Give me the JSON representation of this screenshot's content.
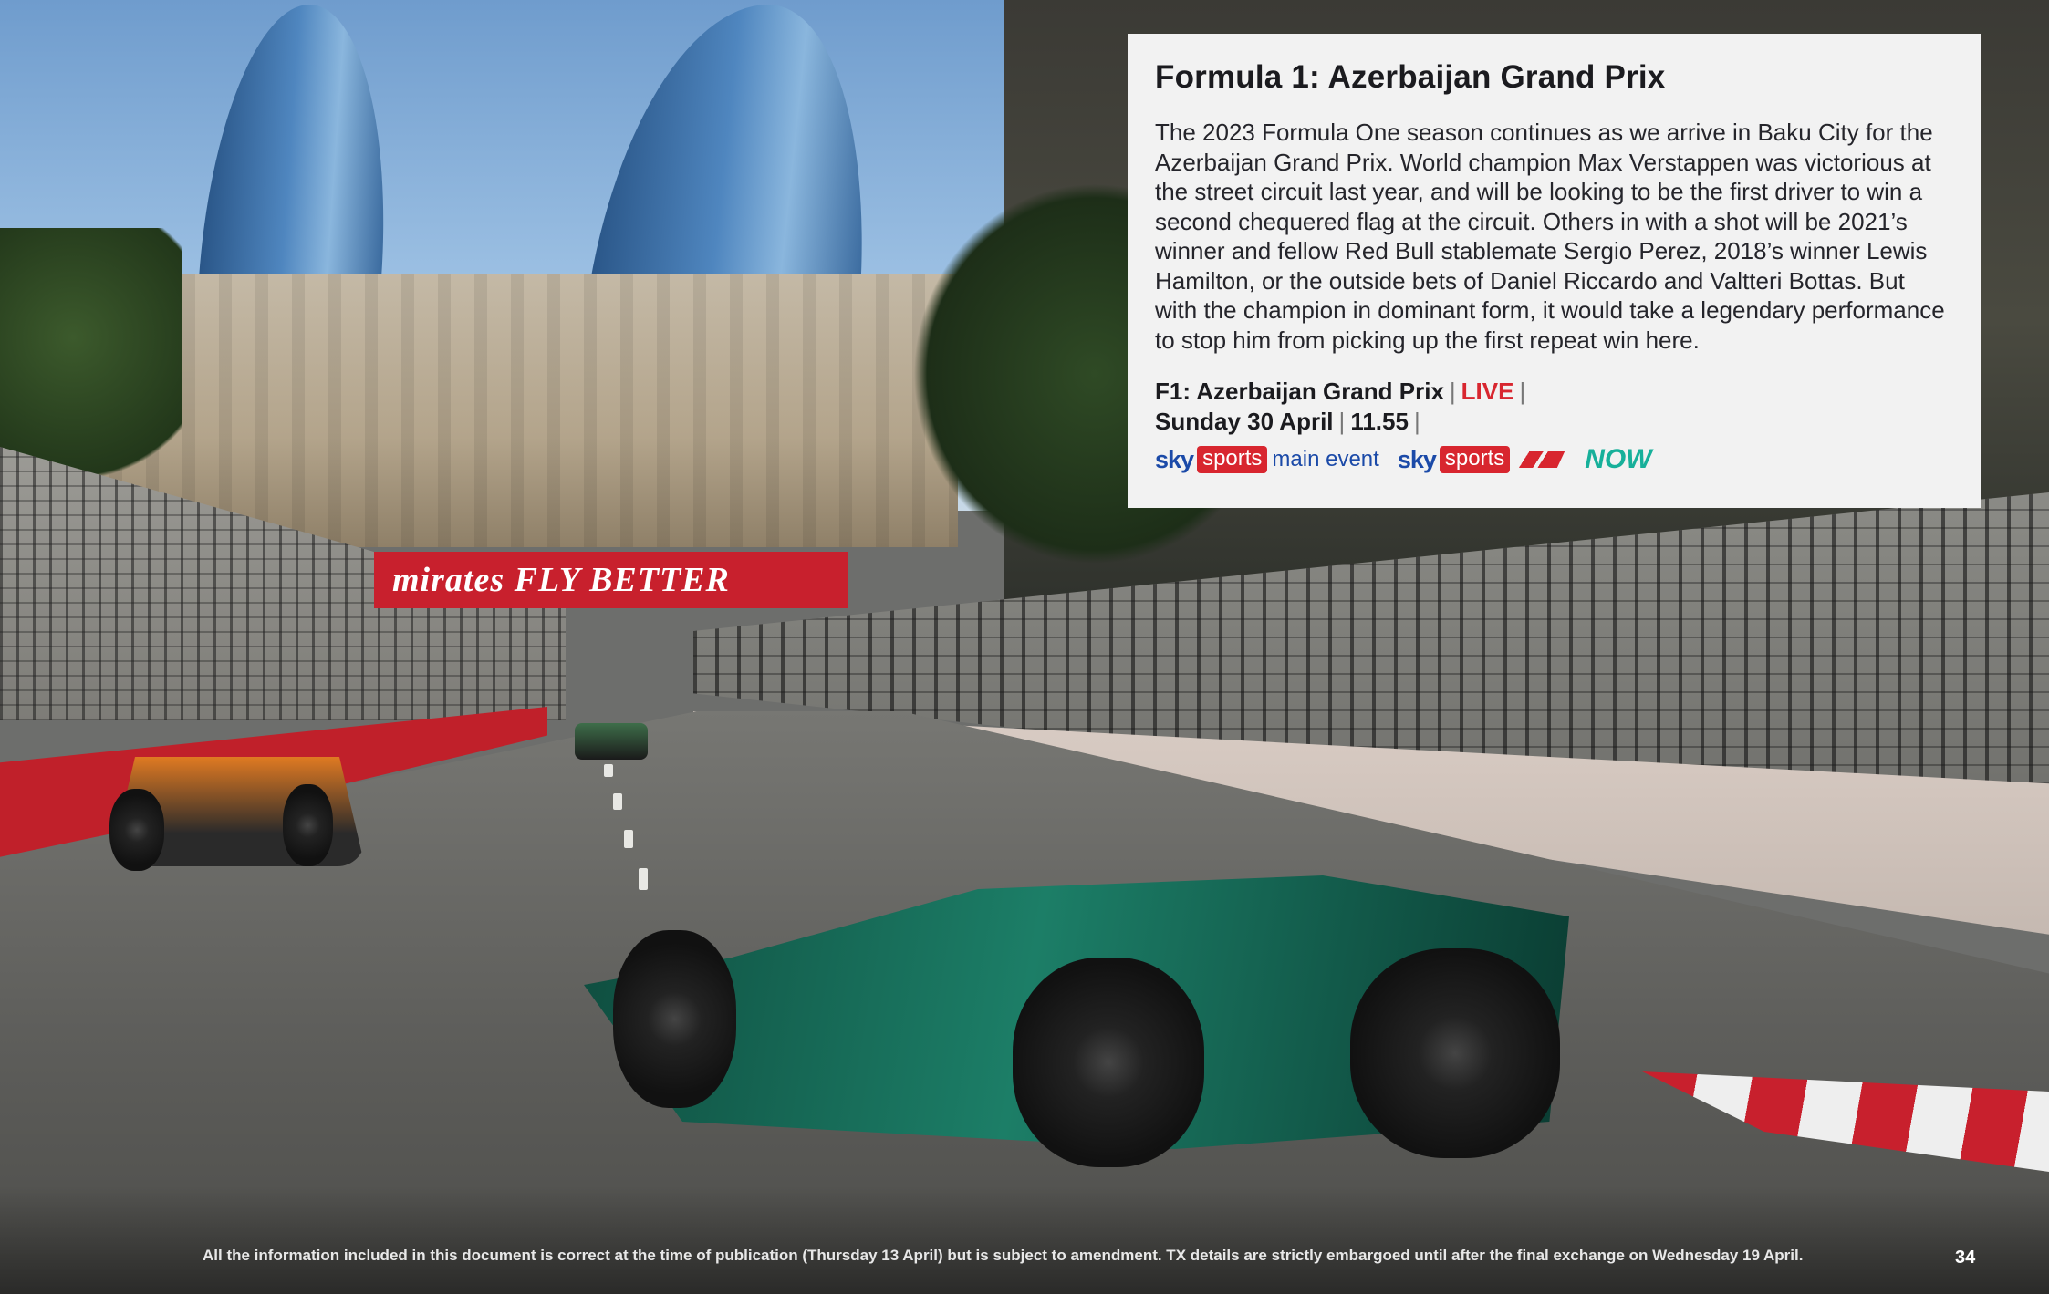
{
  "card": {
    "title": "Formula 1: Azerbaijan Grand Prix",
    "description": "The 2023 Formula One season continues as we arrive in Baku City for the Azerbaijan Grand Prix. World champion Max Verstappen was victorious at the street circuit last year, and will be looking to be the first driver to win a second chequered flag at the circuit. Others in with a shot will be 2021’s winner and fellow Red Bull stablemate Sergio Perez, 2018’s winner Lewis Hamilton, or the outside bets of Daniel Riccardo and Valtteri Bottas. But with the champion in dominant form, it would take a legendary performance to stop him from picking up the first repeat win here.",
    "listing": {
      "event": "F1: Azerbaijan Grand Prix",
      "live_label": "LIVE",
      "date": "Sunday 30 April",
      "time": "11.55",
      "separator": "|"
    },
    "channels": [
      {
        "sky": "sky",
        "sports": "sports",
        "sub": "main event"
      },
      {
        "sky": "sky",
        "sports": "sports",
        "sub_icon": "f1-logo-icon"
      },
      {
        "name": "NOW"
      }
    ]
  },
  "photo": {
    "banner_text": "mirates FLY BETTER",
    "barrier_text": "FLY BE"
  },
  "footer": {
    "disclaimer": "All the information included in this document is correct at the time of publication (Thursday 13 April) but is subject to amendment. TX details are strictly embargoed until after the final exchange on Wednesday 19 April.",
    "page_number": "34"
  },
  "colors": {
    "accent_red": "#d8262f",
    "sky_blue": "#1b4aa8",
    "now_teal": "#17b09a",
    "card_bg": "#f2f2f2"
  }
}
